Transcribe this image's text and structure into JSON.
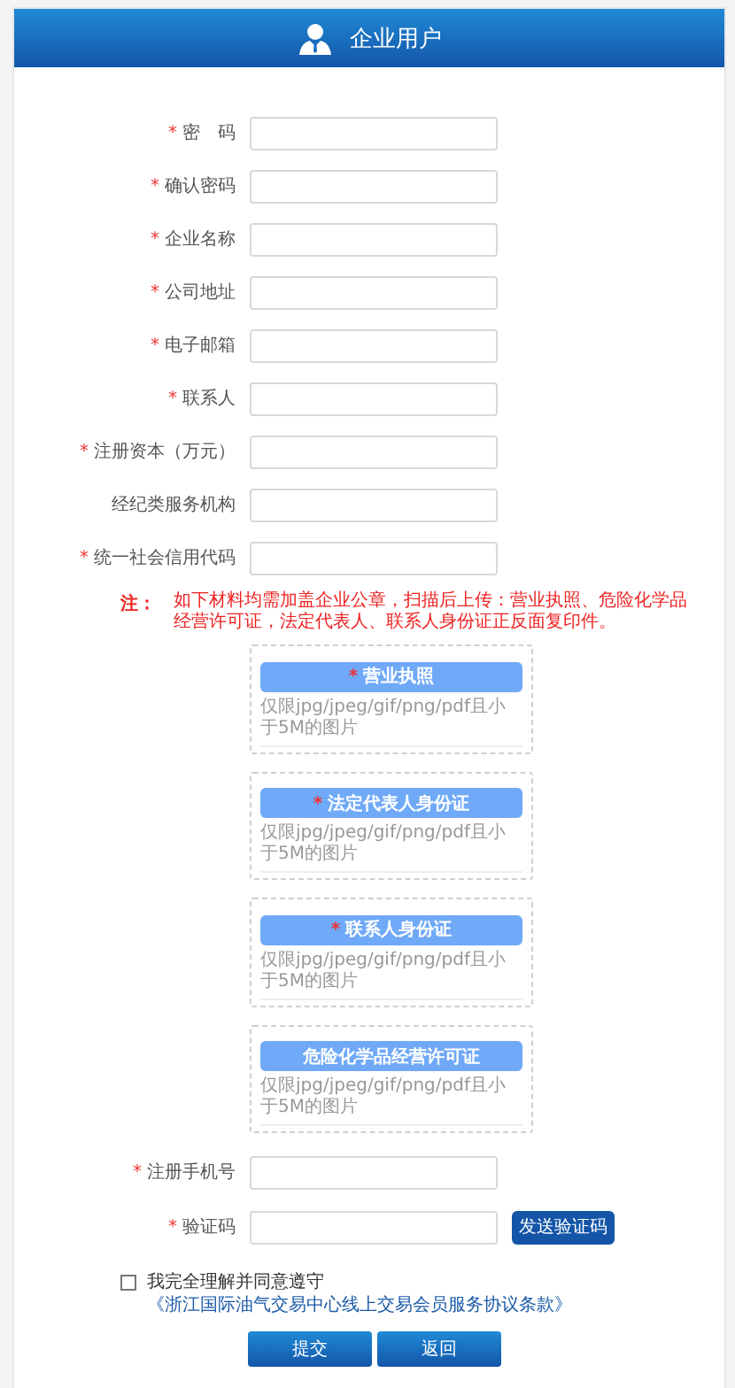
{
  "header": {
    "title": "企业用户"
  },
  "fields": [
    {
      "mark": "*",
      "label": "密　码"
    },
    {
      "mark": "*",
      "label": "确认密码"
    },
    {
      "mark": "*",
      "label": "企业名称"
    },
    {
      "mark": "*",
      "label": "公司地址"
    },
    {
      "mark": "*",
      "label": "电子邮箱"
    },
    {
      "mark": "*",
      "label": "联系人"
    },
    {
      "mark": "*",
      "label": "注册资本（万元）"
    },
    {
      "label": "经纪类服务机构"
    },
    {
      "mark": "*",
      "label": "统一社会信用代码"
    }
  ],
  "note": {
    "label": "注：",
    "text": "如下材料均需加盖企业公章，扫描后上传：营业执照、危险化学品经营许可证，法定代表人、联系人身份证正反面复印件。"
  },
  "uploads": [
    {
      "mark": "*",
      "button": "营业执照",
      "hint": "仅限jpg/jpeg/gif/png/pdf且小于5M的图片"
    },
    {
      "mark": "*",
      "button": "法定代表人身份证",
      "hint": "仅限jpg/jpeg/gif/png/pdf且小于5M的图片"
    },
    {
      "mark": "*",
      "button": "联系人身份证",
      "hint": "仅限jpg/jpeg/gif/png/pdf且小于5M的图片"
    },
    {
      "button": "危险化学品经营许可证",
      "hint": "仅限jpg/jpeg/gif/png/pdf且小于5M的图片"
    }
  ],
  "phone": {
    "mark": "*",
    "label": "注册手机号"
  },
  "code": {
    "mark": "*",
    "label": "验证码",
    "button": "发送验证码"
  },
  "agreement": {
    "checked": false,
    "text": "我完全理解并同意遵守",
    "link": "《浙江国际油气交易中心线上交易会员服务协议条款》"
  },
  "buttons": [
    "提交",
    "返回"
  ]
}
